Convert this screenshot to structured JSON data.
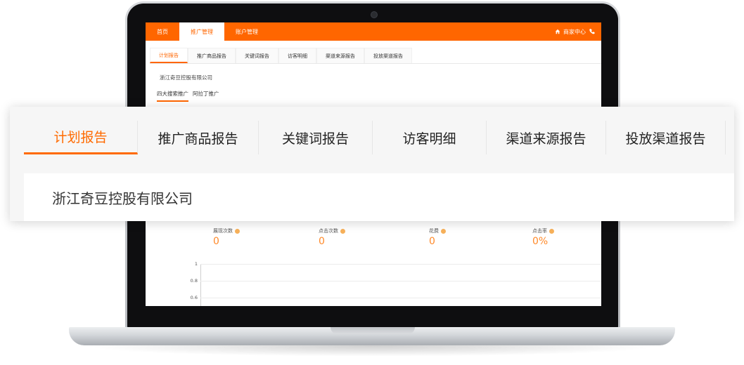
{
  "top_nav": {
    "items": [
      "首页",
      "推广管理",
      "账户管理"
    ],
    "active_index": 1,
    "merchant_center": "商家中心"
  },
  "sub_tabs": {
    "items": [
      "计划报告",
      "推广商品报告",
      "关键词报告",
      "访客明细",
      "渠道来源报告",
      "投放渠道报告"
    ],
    "active_index": 0
  },
  "company_name": "浙江奇豆控股有限公司",
  "spread_tabs": {
    "items": [
      "四大搜索推广",
      "阿拉丁推广"
    ],
    "active_index": 0
  },
  "metrics": [
    {
      "label": "展现次数",
      "value": "0"
    },
    {
      "label": "点击次数",
      "value": "0"
    },
    {
      "label": "花费",
      "value": "0"
    },
    {
      "label": "点击率",
      "value": "0%"
    }
  ],
  "chart_data": {
    "type": "line",
    "y_ticks": [
      "1",
      "0.8",
      "0.6"
    ],
    "ylim": [
      0,
      1
    ],
    "series": []
  },
  "colors": {
    "accent": "#ff6600",
    "metric_value": "#ff8a2a"
  },
  "icons": {
    "home": "home-icon",
    "phone": "phone-icon",
    "help": "help-icon"
  }
}
